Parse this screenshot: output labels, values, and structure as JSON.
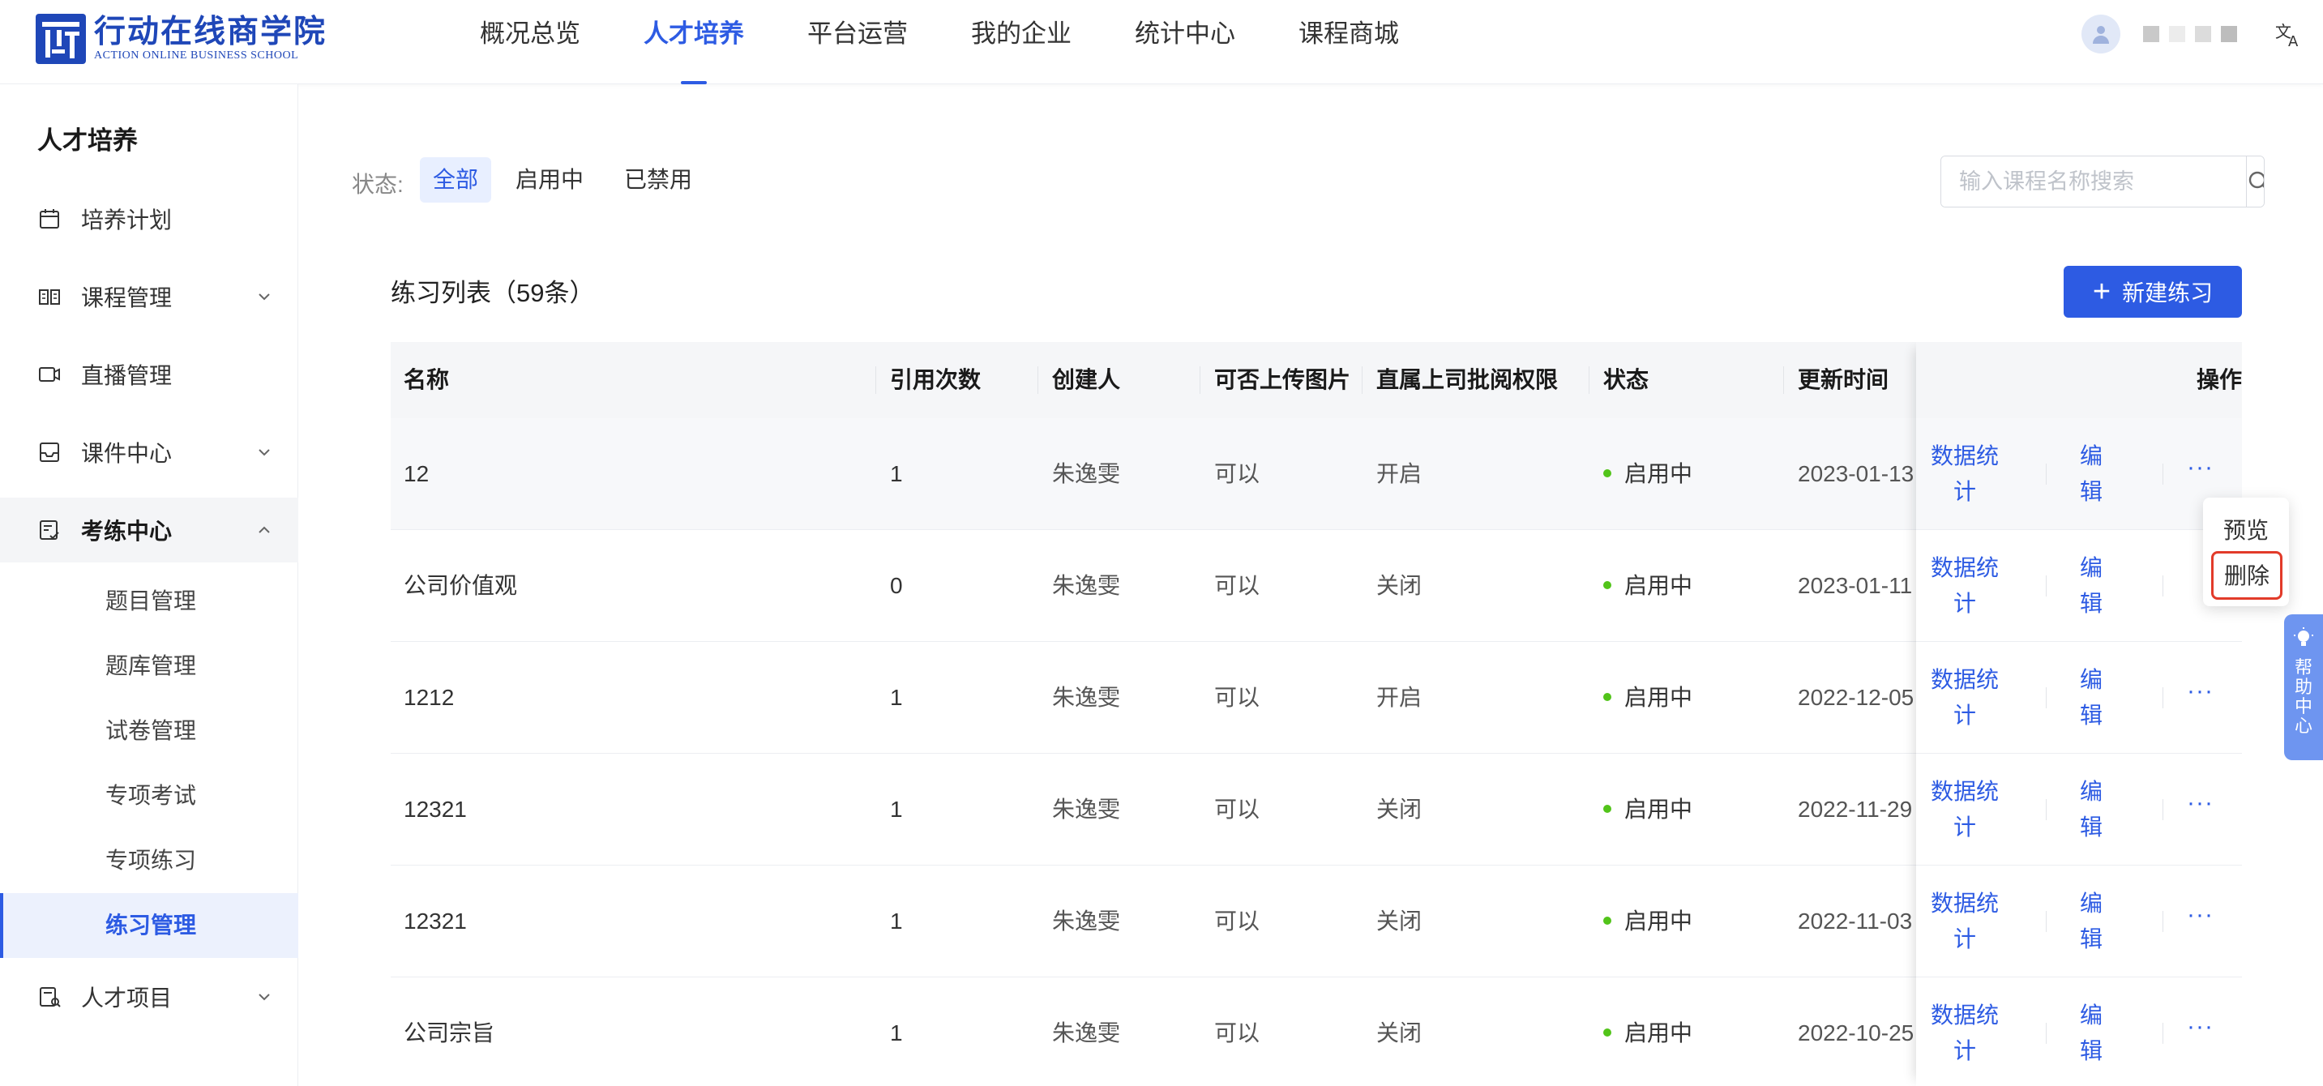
{
  "logo": {
    "name_cn": "行动在线商学院",
    "name_en": "ACTION ONLINE BUSINESS SCHOOL"
  },
  "nav": [
    {
      "label": "概况总览"
    },
    {
      "label": "人才培养"
    },
    {
      "label": "平台运营"
    },
    {
      "label": "我的企业"
    },
    {
      "label": "统计中心"
    },
    {
      "label": "课程商城"
    }
  ],
  "nav_active_index": 1,
  "sidebar": {
    "title": "人才培养",
    "items": [
      {
        "label": "培养计划",
        "icon": "calendar-icon"
      },
      {
        "label": "课程管理",
        "icon": "book-icon"
      },
      {
        "label": "直播管理",
        "icon": "video-icon"
      },
      {
        "label": "课件中心",
        "icon": "inbox-icon"
      },
      {
        "label": "考练中心",
        "icon": "exam-icon"
      },
      {
        "label": "人才项目",
        "icon": "project-icon"
      }
    ],
    "sub_items": [
      {
        "label": "题目管理"
      },
      {
        "label": "题库管理"
      },
      {
        "label": "试卷管理"
      },
      {
        "label": "专项考试"
      },
      {
        "label": "专项练习"
      },
      {
        "label": "练习管理"
      }
    ]
  },
  "filter": {
    "label": "状态:",
    "options": [
      "全部",
      "启用中",
      "已禁用"
    ],
    "active": "全部"
  },
  "search": {
    "placeholder": "输入课程名称搜索"
  },
  "list": {
    "title": "练习列表（59条）",
    "new_button": "新建练习"
  },
  "table": {
    "columns": [
      "名称",
      "引用次数",
      "创建人",
      "可否上传图片",
      "直属上司批阅权限",
      "状态",
      "更新时间",
      "操作"
    ],
    "rows": [
      {
        "name": "12",
        "refs": "1",
        "creator": "朱逸雯",
        "upload": "可以",
        "review": "开启",
        "status": "启用中",
        "updated": "2023-01-13"
      },
      {
        "name": "公司价值观",
        "refs": "0",
        "creator": "朱逸雯",
        "upload": "可以",
        "review": "关闭",
        "status": "启用中",
        "updated": "2023-01-11"
      },
      {
        "name": "1212",
        "refs": "1",
        "creator": "朱逸雯",
        "upload": "可以",
        "review": "开启",
        "status": "启用中",
        "updated": "2022-12-05"
      },
      {
        "name": "12321",
        "refs": "1",
        "creator": "朱逸雯",
        "upload": "可以",
        "review": "关闭",
        "status": "启用中",
        "updated": "2022-11-29"
      },
      {
        "name": "12321",
        "refs": "1",
        "creator": "朱逸雯",
        "upload": "可以",
        "review": "关闭",
        "status": "启用中",
        "updated": "2022-11-03"
      },
      {
        "name": "公司宗旨",
        "refs": "1",
        "creator": "朱逸雯",
        "upload": "可以",
        "review": "关闭",
        "status": "启用中",
        "updated": "2022-10-25"
      }
    ],
    "actions": {
      "stats_line1": "数据统",
      "stats_line2": "计",
      "edit_line1": "编",
      "edit_line2": "辑",
      "more": "···"
    }
  },
  "dropdown": {
    "items": [
      "预览",
      "删除"
    ]
  },
  "help": {
    "label": "帮助中心"
  },
  "colors": {
    "primary": "#2d5be3",
    "status_on": "#52c41a",
    "highlight": "#e23b2a",
    "help_tab": "#6e95f0"
  }
}
